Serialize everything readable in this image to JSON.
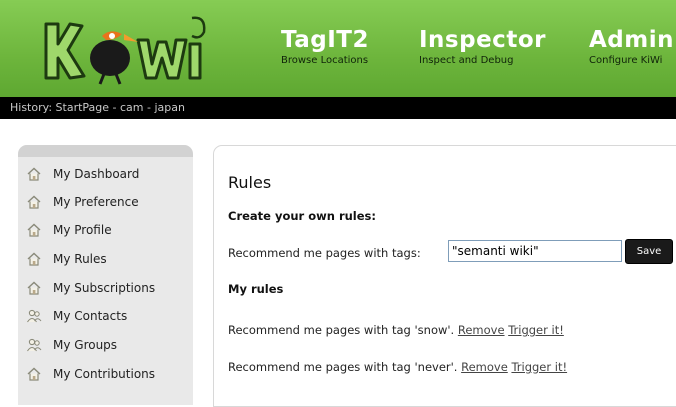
{
  "brand": {
    "logo_text": "KiWi"
  },
  "nav": [
    {
      "title": "TagIT2",
      "subtitle": "Browse Locations"
    },
    {
      "title": "Inspector",
      "subtitle": "Inspect and Debug"
    },
    {
      "title": "Admin",
      "subtitle": "Configure KiWi"
    }
  ],
  "history": {
    "text": "History: StartPage - cam - japan"
  },
  "sidebar": {
    "items": [
      {
        "label": "My Dashboard",
        "icon": "home-icon"
      },
      {
        "label": "My Preference",
        "icon": "home-icon"
      },
      {
        "label": "My Profile",
        "icon": "home-icon"
      },
      {
        "label": "My Rules",
        "icon": "home-icon"
      },
      {
        "label": "My Subscriptions",
        "icon": "home-icon"
      },
      {
        "label": "My Contacts",
        "icon": "users-icon"
      },
      {
        "label": "My Groups",
        "icon": "users-icon"
      },
      {
        "label": "My Contributions",
        "icon": "home-icon"
      }
    ]
  },
  "main": {
    "title": "Rules",
    "create_heading": "Create your own rules:",
    "recommend_label": "Recommend me pages with tags:",
    "tag_input_value": "\"semanti wiki\"",
    "save_label": "Save",
    "my_rules_heading": "My rules",
    "rules": [
      {
        "text": "Recommend me pages with tag 'snow'.",
        "remove": "Remove",
        "trigger": "Trigger it!"
      },
      {
        "text": "Recommend me pages with tag 'never'.",
        "remove": "Remove",
        "trigger": "Trigger it!"
      }
    ]
  },
  "colors": {
    "header_green": "#6db53c",
    "history_bar": "#000000",
    "sidebar_bg": "#e9e9e9"
  }
}
